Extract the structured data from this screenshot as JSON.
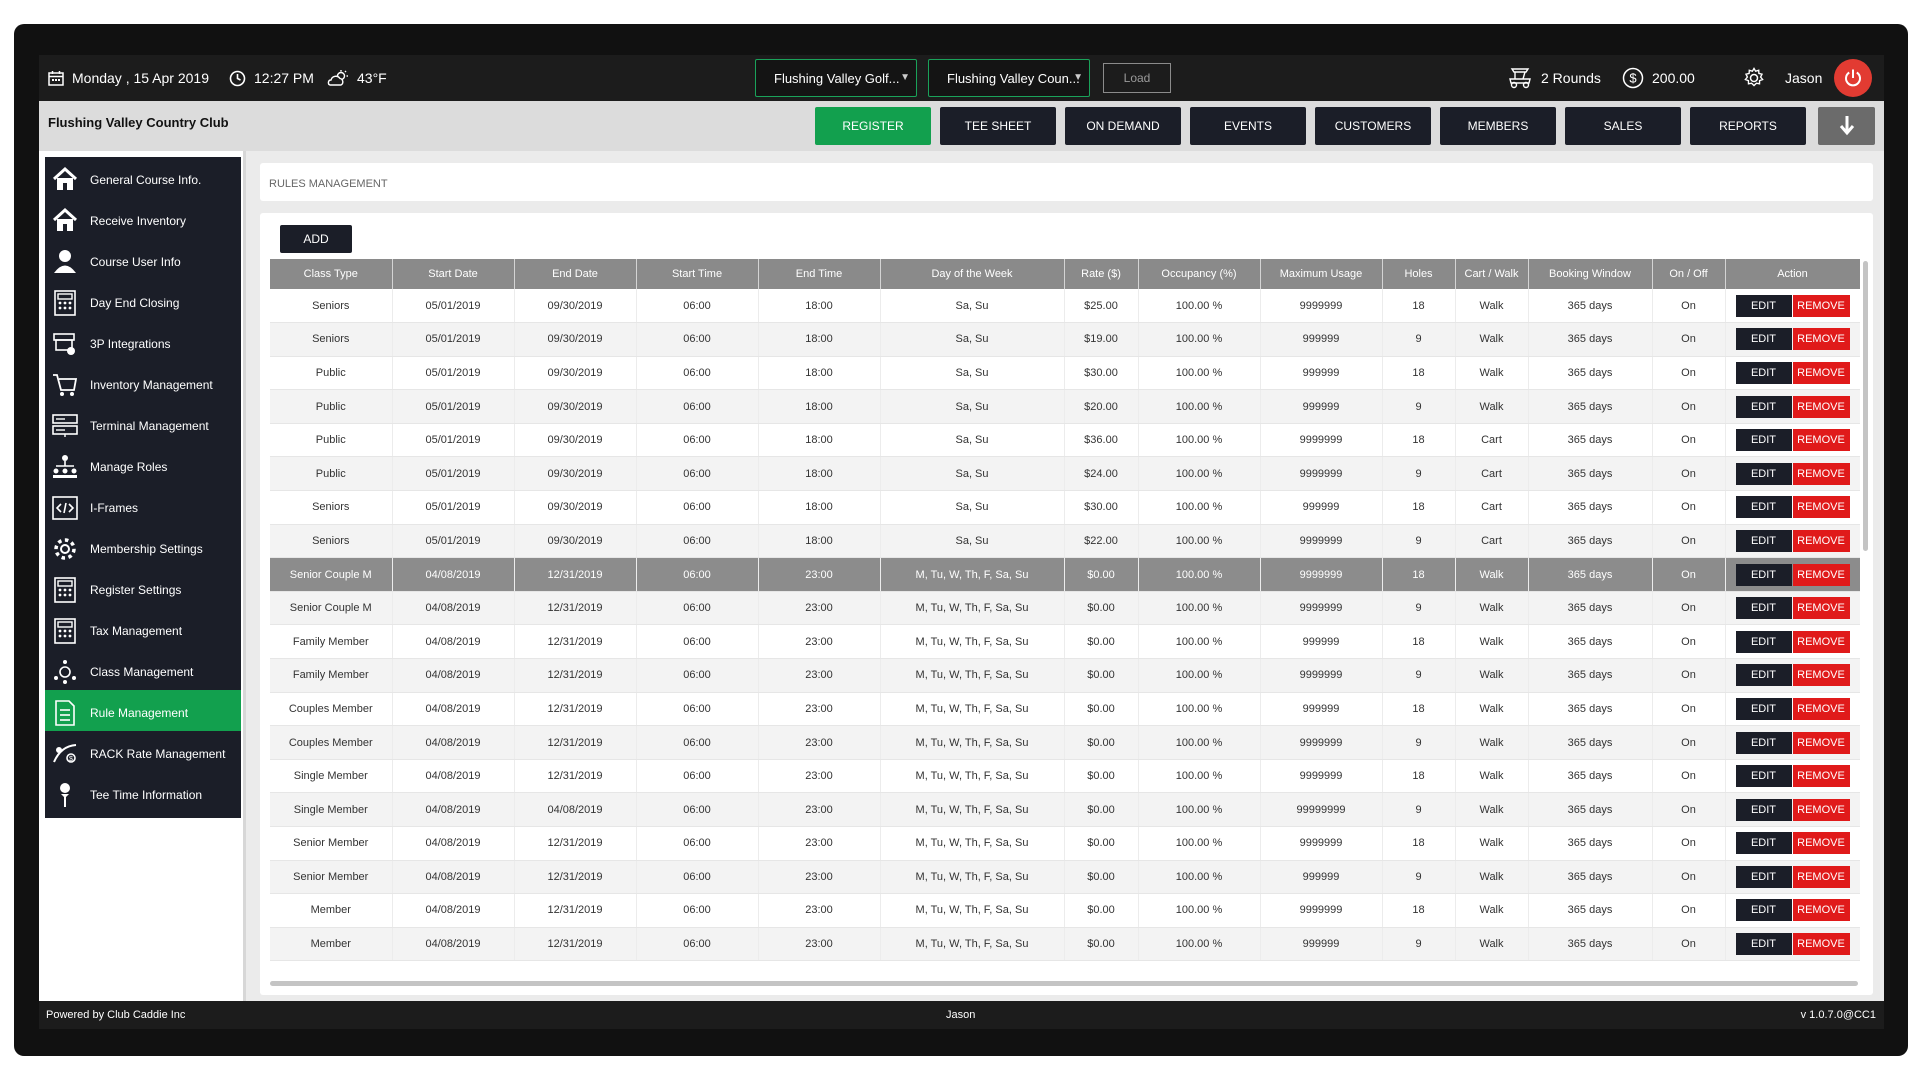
{
  "topbar": {
    "date": "Monday ,  15 Apr 2019",
    "time": "12:27 PM",
    "weather": "43°F",
    "course_select_1": "Flushing Valley Golf...",
    "course_select_2": "Flushing Valley Coun...",
    "load_label": "Load",
    "rounds": "2 Rounds",
    "balance": "200.00",
    "user": "Jason",
    "icons": {
      "date": "calendar-icon",
      "time": "clock-icon",
      "weather": "partly-cloudy-icon",
      "rounds": "golf-cart-icon",
      "balance": "dollar-icon",
      "settings": "gear-icon",
      "power": "power-icon"
    }
  },
  "navbar": {
    "club_name": "Flushing Valley Country Club",
    "buttons": [
      "REGISTER",
      "TEE SHEET",
      "ON DEMAND",
      "EVENTS",
      "CUSTOMERS",
      "MEMBERS",
      "SALES",
      "REPORTS"
    ],
    "active": "REGISTER",
    "download_icon": "arrow-down-icon"
  },
  "sidebar": {
    "items": [
      {
        "label": "General Course Info.",
        "icon": "home-icon"
      },
      {
        "label": "Receive Inventory",
        "icon": "home-icon"
      },
      {
        "label": "Course User Info",
        "icon": "user-icon"
      },
      {
        "label": "Day End Closing",
        "icon": "calculator-icon"
      },
      {
        "label": "3P Integrations",
        "icon": "integration-icon"
      },
      {
        "label": "Inventory Management",
        "icon": "cart-icon"
      },
      {
        "label": "Terminal Management",
        "icon": "terminal-icon"
      },
      {
        "label": "Manage Roles",
        "icon": "org-chart-icon"
      },
      {
        "label": "I-Frames",
        "icon": "code-icon"
      },
      {
        "label": "Membership Settings",
        "icon": "gear-icon"
      },
      {
        "label": "Register Settings",
        "icon": "calculator-icon"
      },
      {
        "label": "Tax Management",
        "icon": "calculator-icon"
      },
      {
        "label": "Class Management",
        "icon": "class-icon"
      },
      {
        "label": "Rule Management",
        "icon": "document-icon"
      },
      {
        "label": "RACK Rate Management",
        "icon": "rate-icon"
      },
      {
        "label": "Tee Time Information",
        "icon": "golf-tee-icon"
      }
    ],
    "active_index": 13
  },
  "main": {
    "title": "RULES MANAGEMENT",
    "add_label": "ADD",
    "columns": [
      "Class Type",
      "Start Date",
      "End Date",
      "Start Time",
      "End Time",
      "Day of the Week",
      "Rate ($)",
      "Occupancy (%)",
      "Maximum Usage",
      "Holes",
      "Cart / Walk",
      "Booking Window",
      "On / Off",
      "Action"
    ],
    "edit_label": "EDIT",
    "remove_label": "REMOVE",
    "selected_row": 8,
    "rows": [
      [
        "Seniors",
        "05/01/2019",
        "09/30/2019",
        "06:00",
        "18:00",
        "Sa, Su",
        "$25.00",
        "100.00 %",
        "9999999",
        "18",
        "Walk",
        "365 days",
        "On"
      ],
      [
        "Seniors",
        "05/01/2019",
        "09/30/2019",
        "06:00",
        "18:00",
        "Sa, Su",
        "$19.00",
        "100.00 %",
        "999999",
        "9",
        "Walk",
        "365 days",
        "On"
      ],
      [
        "Public",
        "05/01/2019",
        "09/30/2019",
        "06:00",
        "18:00",
        "Sa, Su",
        "$30.00",
        "100.00 %",
        "999999",
        "18",
        "Walk",
        "365 days",
        "On"
      ],
      [
        "Public",
        "05/01/2019",
        "09/30/2019",
        "06:00",
        "18:00",
        "Sa, Su",
        "$20.00",
        "100.00 %",
        "999999",
        "9",
        "Walk",
        "365 days",
        "On"
      ],
      [
        "Public",
        "05/01/2019",
        "09/30/2019",
        "06:00",
        "18:00",
        "Sa, Su",
        "$36.00",
        "100.00 %",
        "9999999",
        "18",
        "Cart",
        "365 days",
        "On"
      ],
      [
        "Public",
        "05/01/2019",
        "09/30/2019",
        "06:00",
        "18:00",
        "Sa, Su",
        "$24.00",
        "100.00 %",
        "9999999",
        "9",
        "Cart",
        "365 days",
        "On"
      ],
      [
        "Seniors",
        "05/01/2019",
        "09/30/2019",
        "06:00",
        "18:00",
        "Sa, Su",
        "$30.00",
        "100.00 %",
        "999999",
        "18",
        "Cart",
        "365 days",
        "On"
      ],
      [
        "Seniors",
        "05/01/2019",
        "09/30/2019",
        "06:00",
        "18:00",
        "Sa, Su",
        "$22.00",
        "100.00 %",
        "9999999",
        "9",
        "Cart",
        "365 days",
        "On"
      ],
      [
        "Senior Couple M",
        "04/08/2019",
        "12/31/2019",
        "06:00",
        "23:00",
        "M, Tu, W, Th, F, Sa, Su",
        "$0.00",
        "100.00 %",
        "9999999",
        "18",
        "Walk",
        "365 days",
        "On"
      ],
      [
        "Senior Couple M",
        "04/08/2019",
        "12/31/2019",
        "06:00",
        "23:00",
        "M, Tu, W, Th, F, Sa, Su",
        "$0.00",
        "100.00 %",
        "9999999",
        "9",
        "Walk",
        "365 days",
        "On"
      ],
      [
        "Family Member",
        "04/08/2019",
        "12/31/2019",
        "06:00",
        "23:00",
        "M, Tu, W, Th, F, Sa, Su",
        "$0.00",
        "100.00 %",
        "999999",
        "18",
        "Walk",
        "365 days",
        "On"
      ],
      [
        "Family Member",
        "04/08/2019",
        "12/31/2019",
        "06:00",
        "23:00",
        "M, Tu, W, Th, F, Sa, Su",
        "$0.00",
        "100.00 %",
        "9999999",
        "9",
        "Walk",
        "365 days",
        "On"
      ],
      [
        "Couples Member",
        "04/08/2019",
        "12/31/2019",
        "06:00",
        "23:00",
        "M, Tu, W, Th, F, Sa, Su",
        "$0.00",
        "100.00 %",
        "999999",
        "18",
        "Walk",
        "365 days",
        "On"
      ],
      [
        "Couples Member",
        "04/08/2019",
        "12/31/2019",
        "06:00",
        "23:00",
        "M, Tu, W, Th, F, Sa, Su",
        "$0.00",
        "100.00 %",
        "9999999",
        "9",
        "Walk",
        "365 days",
        "On"
      ],
      [
        "Single Member",
        "04/08/2019",
        "12/31/2019",
        "06:00",
        "23:00",
        "M, Tu, W, Th, F, Sa, Su",
        "$0.00",
        "100.00 %",
        "9999999",
        "18",
        "Walk",
        "365 days",
        "On"
      ],
      [
        "Single Member",
        "04/08/2019",
        "04/08/2019",
        "06:00",
        "23:00",
        "M, Tu, W, Th, F, Sa, Su",
        "$0.00",
        "100.00 %",
        "99999999",
        "9",
        "Walk",
        "365 days",
        "On"
      ],
      [
        "Senior Member",
        "04/08/2019",
        "12/31/2019",
        "06:00",
        "23:00",
        "M, Tu, W, Th, F, Sa, Su",
        "$0.00",
        "100.00 %",
        "9999999",
        "18",
        "Walk",
        "365 days",
        "On"
      ],
      [
        "Senior Member",
        "04/08/2019",
        "12/31/2019",
        "06:00",
        "23:00",
        "M, Tu, W, Th, F, Sa, Su",
        "$0.00",
        "100.00 %",
        "999999",
        "9",
        "Walk",
        "365 days",
        "On"
      ],
      [
        "Member",
        "04/08/2019",
        "12/31/2019",
        "06:00",
        "23:00",
        "M, Tu, W, Th, F, Sa, Su",
        "$0.00",
        "100.00 %",
        "9999999",
        "18",
        "Walk",
        "365 days",
        "On"
      ],
      [
        "Member",
        "04/08/2019",
        "12/31/2019",
        "06:00",
        "23:00",
        "M, Tu, W, Th, F, Sa, Su",
        "$0.00",
        "100.00 %",
        "999999",
        "9",
        "Walk",
        "365 days",
        "On"
      ]
    ]
  },
  "footer": {
    "left": "Powered by Club Caddie Inc",
    "center": "Jason",
    "right": "v 1.0.7.0@CC1"
  },
  "colors": {
    "accent": "#12a04e",
    "dark": "#1b1e28",
    "danger": "#e01a1a",
    "power": "#e23b32"
  }
}
